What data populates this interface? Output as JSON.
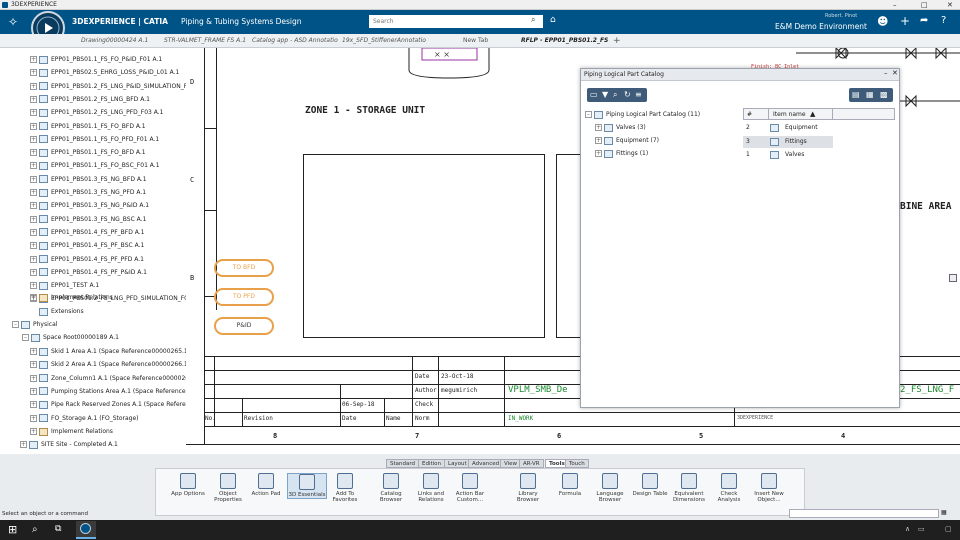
{
  "window": {
    "title": "3DEXPERIENCE"
  },
  "app": {
    "brand": "3DEXPERIENCE | CATIA",
    "app_name": "Piping & Tubing Systems Design",
    "search_placeholder": "Search",
    "user": "Robert. Pinot",
    "environment": "E&M Demo Environment"
  },
  "tabs": [
    {
      "label": "Drawing00000424 A.1"
    },
    {
      "label": "STR-VALMET_FRAME FS A.1"
    },
    {
      "label": "Catalog app - ASD Annotatio"
    },
    {
      "label": "19x_SFD_StiffenerAnnotatio"
    },
    {
      "label": "New Tab"
    },
    {
      "label": "RFLP - EPP01_PBS01.2_FS"
    }
  ],
  "tree": {
    "items": [
      "EPP01_PBS01.1_FS_FO_P&ID_F01 A.1",
      "EPP01_PBS02.5_EHRG_LOSS_P&ID_L01 A.1",
      "EPP01_PBS01.2_FS_LNG_P&ID_SIMULATION_F03 A",
      "EPP01_PBS01.2_FS_LNG_BFD A.1",
      "EPP01_PBS01.2_FS_LNG_PFD_F03 A.1",
      "EPP01_PBS01.1_FS_FO_BFD A.1",
      "EPP01_PBS01.1_FS_FO_PFD_F01 A.1",
      "EPP01_PBS01.1_FS_FO_BFD A.1",
      "EPP01_PBS01.1_FS_FO_BSC_F01 A.1",
      "EPP01_PBS01.3_FS_NG_BFD A.1",
      "EPP01_PBS01.3_FS_NG_PFD A.1",
      "EPP01_PBS01.3_FS_NG_P&ID A.1",
      "EPP01_PBS01.3_FS_NG_BSC A.1",
      "EPP01_PBS01.4_FS_PF_BFD A.1",
      "EPP01_PBS01.4_FS_PF_BSC A.1",
      "EPP01_PBS01.4_FS_PF_PFD A.1",
      "EPP01_PBS01.4_FS_PF_P&ID A.1",
      "EPP01_TEST A.1",
      "EPP01_PBS01.2_FS_LNG_PFD_SIMULATION_F03 A"
    ],
    "implement_relations": "Implement Relations",
    "extensions": "Extensions",
    "physical": "Physical",
    "space_root": "Space Root00000189 A.1",
    "physical_items": [
      "Skid 1 Area A.1 (Space Reference00000265.1)",
      "Skid 2 Area A.1 (Space Reference00000266.1)",
      "Zone_Column1 A.1 (Space Reference00000267.1)",
      "Pumping Stations Area A.1 (Space Reference0000026",
      "Pipe Rack Reserved Zones A.1 (Space Reference000",
      "FO_Storage A.1 (FO_Storage)"
    ],
    "implement_relations_2": "Implement Relations",
    "site": "SITE Site - Completed A.1"
  },
  "drawing": {
    "zone_title": "ZONE 1 - STORAGE UNIT",
    "zone_right": "BINE AREA",
    "row_markers": [
      "D",
      "C",
      "B"
    ],
    "pills": [
      "TO BFD",
      "TO PFD",
      "P&ID"
    ],
    "date_label": "Date",
    "date_value": "23-Oct-18",
    "author_label": "Author",
    "author_value": "megumirich",
    "check_label": "Check",
    "rev_date": "06-Sep-18",
    "table_headers": [
      "No.",
      "Revision",
      "Date",
      "Name",
      "Norm"
    ],
    "status": "IN_WORK",
    "doc_title": "VPLM_SMB_De",
    "doc_title_right": "2_FS_LNG_F",
    "col_numbers": [
      "8",
      "7",
      "6",
      "5",
      "4"
    ],
    "finish": "Finish: BC Inlet",
    "threeds": "3DEXPERIENCE"
  },
  "catalog": {
    "title": "Piping Logical Part Catalog",
    "root": "Piping Logical Part Catalog (11)",
    "children": [
      "Valves (3)",
      "Equipment (7)",
      "Fittings (1)"
    ],
    "col_num": "#",
    "col_name": "Item name",
    "rows": [
      {
        "num": "2",
        "name": "Equipment"
      },
      {
        "num": "3",
        "name": "Fittings"
      },
      {
        "num": "1",
        "name": "Valves"
      }
    ]
  },
  "section_tabs": [
    "Standard",
    "Edition",
    "Layout",
    "Advanced",
    "View",
    "AR-VR",
    "Tools",
    "Touch"
  ],
  "active_section": "Tools",
  "toolbar": [
    {
      "label": "App Options",
      "icon": "app-options-icon"
    },
    {
      "label": "Object Properties",
      "icon": "properties-icon"
    },
    {
      "label": "Action Pad",
      "icon": "action-pad-icon"
    },
    {
      "label": "3D Essentials",
      "icon": "essentials-icon"
    },
    {
      "label": "Add To Favorites",
      "icon": "star-icon"
    },
    {
      "label": "Catalog Browser",
      "icon": "catalog-icon"
    },
    {
      "label": "Links and Relations",
      "icon": "links-icon"
    },
    {
      "label": "Action Bar Custom...",
      "icon": "action-bar-icon"
    },
    {
      "label": "Library Browser",
      "icon": "library-icon"
    },
    {
      "label": "Formula",
      "icon": "formula-icon"
    },
    {
      "label": "Language Browser",
      "icon": "language-icon"
    },
    {
      "label": "Design Table",
      "icon": "table-icon"
    },
    {
      "label": "Equivalent Dimensions",
      "icon": "dimension-icon"
    },
    {
      "label": "Check Analysis",
      "icon": "check-icon"
    },
    {
      "label": "Insert New Object...",
      "icon": "insert-icon"
    }
  ],
  "statusbar": {
    "text": "Select an object or a command"
  },
  "colors": {
    "app_blue": "#005386",
    "accent_orange": "#e8a04a",
    "green_text": "#1a8a2e"
  }
}
